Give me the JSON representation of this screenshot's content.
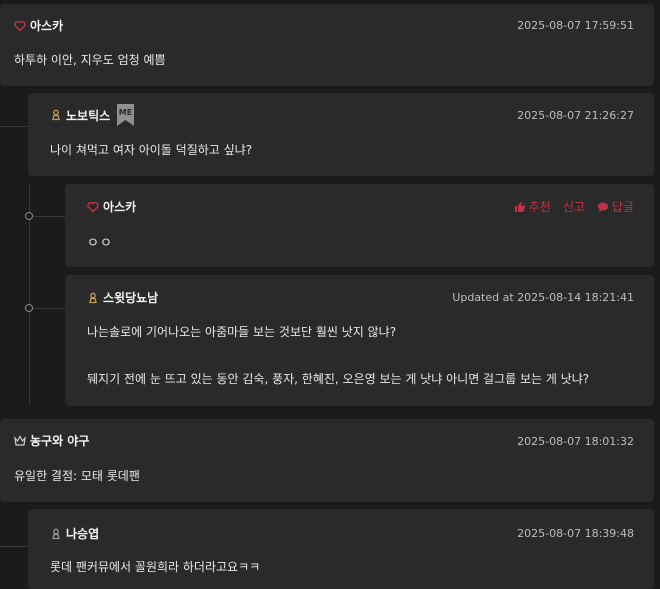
{
  "comments": [
    {
      "user": "아스카",
      "date": "2025-08-07 17:59:51",
      "text": "하투하 이안, 지우도 엄청 예쁨"
    },
    {
      "user": "노보틱스",
      "badge": "ME",
      "date": "2025-08-07 21:26:27",
      "text": "나이 쳐먹고 여자 아이돌 덕질하고 싶냐?"
    },
    {
      "user": "아스카",
      "text": "ㅇㅇ",
      "actions": {
        "recommend": "추천",
        "report": "신고",
        "reply": "답글"
      }
    },
    {
      "user": "스윗당뇨남",
      "date": "Updated at 2025-08-14 18:21:41",
      "text1": "나는솔로에 기어나오는 아줌마들 보는 것보단 훨씬 낫지 않냐?",
      "text2": "뒈지기 전에 눈 뜨고 있는 동안 김숙, 풍자, 한혜진, 오은영 보는 게 낫냐 아니면 걸그룹 보는 게 낫냐?"
    },
    {
      "user": "농구와 야구",
      "date": "2025-08-07 18:01:32",
      "text": "유일한 결점: 모태 롯데팬"
    },
    {
      "user": "나승엽",
      "date": "2025-08-07 18:39:48",
      "text": "롯데 팬커뮤에서 꼴원희라 하더라고요ㅋㅋ"
    }
  ],
  "colors": {
    "accent": "#c0334a",
    "card": "#2a2a2a",
    "background": "#1b1b1b"
  }
}
